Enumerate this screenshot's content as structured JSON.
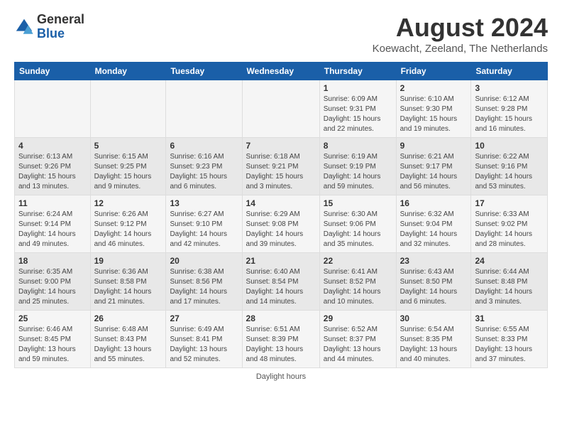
{
  "logo": {
    "general": "General",
    "blue": "Blue"
  },
  "title": "August 2024",
  "subtitle": "Koewacht, Zeeland, The Netherlands",
  "days_of_week": [
    "Sunday",
    "Monday",
    "Tuesday",
    "Wednesday",
    "Thursday",
    "Friday",
    "Saturday"
  ],
  "footer": "Daylight hours",
  "weeks": [
    [
      {
        "num": "",
        "sunrise": "",
        "sunset": "",
        "daylight": ""
      },
      {
        "num": "",
        "sunrise": "",
        "sunset": "",
        "daylight": ""
      },
      {
        "num": "",
        "sunrise": "",
        "sunset": "",
        "daylight": ""
      },
      {
        "num": "",
        "sunrise": "",
        "sunset": "",
        "daylight": ""
      },
      {
        "num": "1",
        "sunrise": "6:09 AM",
        "sunset": "9:31 PM",
        "daylight": "15 hours and 22 minutes."
      },
      {
        "num": "2",
        "sunrise": "6:10 AM",
        "sunset": "9:30 PM",
        "daylight": "15 hours and 19 minutes."
      },
      {
        "num": "3",
        "sunrise": "6:12 AM",
        "sunset": "9:28 PM",
        "daylight": "15 hours and 16 minutes."
      }
    ],
    [
      {
        "num": "4",
        "sunrise": "6:13 AM",
        "sunset": "9:26 PM",
        "daylight": "15 hours and 13 minutes."
      },
      {
        "num": "5",
        "sunrise": "6:15 AM",
        "sunset": "9:25 PM",
        "daylight": "15 hours and 9 minutes."
      },
      {
        "num": "6",
        "sunrise": "6:16 AM",
        "sunset": "9:23 PM",
        "daylight": "15 hours and 6 minutes."
      },
      {
        "num": "7",
        "sunrise": "6:18 AM",
        "sunset": "9:21 PM",
        "daylight": "15 hours and 3 minutes."
      },
      {
        "num": "8",
        "sunrise": "6:19 AM",
        "sunset": "9:19 PM",
        "daylight": "14 hours and 59 minutes."
      },
      {
        "num": "9",
        "sunrise": "6:21 AM",
        "sunset": "9:17 PM",
        "daylight": "14 hours and 56 minutes."
      },
      {
        "num": "10",
        "sunrise": "6:22 AM",
        "sunset": "9:16 PM",
        "daylight": "14 hours and 53 minutes."
      }
    ],
    [
      {
        "num": "11",
        "sunrise": "6:24 AM",
        "sunset": "9:14 PM",
        "daylight": "14 hours and 49 minutes."
      },
      {
        "num": "12",
        "sunrise": "6:26 AM",
        "sunset": "9:12 PM",
        "daylight": "14 hours and 46 minutes."
      },
      {
        "num": "13",
        "sunrise": "6:27 AM",
        "sunset": "9:10 PM",
        "daylight": "14 hours and 42 minutes."
      },
      {
        "num": "14",
        "sunrise": "6:29 AM",
        "sunset": "9:08 PM",
        "daylight": "14 hours and 39 minutes."
      },
      {
        "num": "15",
        "sunrise": "6:30 AM",
        "sunset": "9:06 PM",
        "daylight": "14 hours and 35 minutes."
      },
      {
        "num": "16",
        "sunrise": "6:32 AM",
        "sunset": "9:04 PM",
        "daylight": "14 hours and 32 minutes."
      },
      {
        "num": "17",
        "sunrise": "6:33 AM",
        "sunset": "9:02 PM",
        "daylight": "14 hours and 28 minutes."
      }
    ],
    [
      {
        "num": "18",
        "sunrise": "6:35 AM",
        "sunset": "9:00 PM",
        "daylight": "14 hours and 25 minutes."
      },
      {
        "num": "19",
        "sunrise": "6:36 AM",
        "sunset": "8:58 PM",
        "daylight": "14 hours and 21 minutes."
      },
      {
        "num": "20",
        "sunrise": "6:38 AM",
        "sunset": "8:56 PM",
        "daylight": "14 hours and 17 minutes."
      },
      {
        "num": "21",
        "sunrise": "6:40 AM",
        "sunset": "8:54 PM",
        "daylight": "14 hours and 14 minutes."
      },
      {
        "num": "22",
        "sunrise": "6:41 AM",
        "sunset": "8:52 PM",
        "daylight": "14 hours and 10 minutes."
      },
      {
        "num": "23",
        "sunrise": "6:43 AM",
        "sunset": "8:50 PM",
        "daylight": "14 hours and 6 minutes."
      },
      {
        "num": "24",
        "sunrise": "6:44 AM",
        "sunset": "8:48 PM",
        "daylight": "14 hours and 3 minutes."
      }
    ],
    [
      {
        "num": "25",
        "sunrise": "6:46 AM",
        "sunset": "8:45 PM",
        "daylight": "13 hours and 59 minutes."
      },
      {
        "num": "26",
        "sunrise": "6:48 AM",
        "sunset": "8:43 PM",
        "daylight": "13 hours and 55 minutes."
      },
      {
        "num": "27",
        "sunrise": "6:49 AM",
        "sunset": "8:41 PM",
        "daylight": "13 hours and 52 minutes."
      },
      {
        "num": "28",
        "sunrise": "6:51 AM",
        "sunset": "8:39 PM",
        "daylight": "13 hours and 48 minutes."
      },
      {
        "num": "29",
        "sunrise": "6:52 AM",
        "sunset": "8:37 PM",
        "daylight": "13 hours and 44 minutes."
      },
      {
        "num": "30",
        "sunrise": "6:54 AM",
        "sunset": "8:35 PM",
        "daylight": "13 hours and 40 minutes."
      },
      {
        "num": "31",
        "sunrise": "6:55 AM",
        "sunset": "8:33 PM",
        "daylight": "13 hours and 37 minutes."
      }
    ]
  ]
}
